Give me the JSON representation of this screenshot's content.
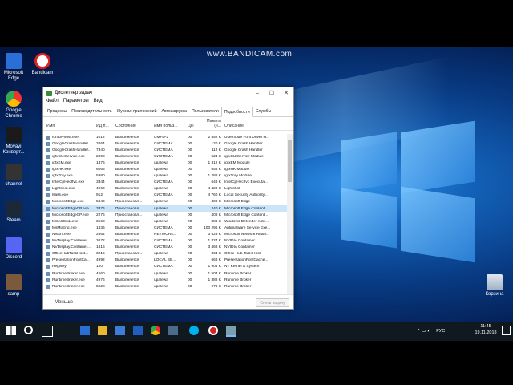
{
  "watermark": "www.BANDICAM.com",
  "desktop_icons": [
    {
      "label": "Microsoft Edge",
      "icon": "edge-icon",
      "color": "#2a6fd6"
    },
    {
      "label": "Bandicam",
      "icon": "bandicam-icon",
      "color": "#d22"
    },
    {
      "label": "Google Chrome",
      "icon": "chrome-icon",
      "color": "#e33"
    },
    {
      "label": "Movavi Конверт...",
      "icon": "movavi-icon",
      "color": "#1a1a1a"
    },
    {
      "label": "channel",
      "icon": "file-icon",
      "color": "#333"
    },
    {
      "label": "Steam",
      "icon": "steam-icon",
      "color": "#1b2838"
    },
    {
      "label": "Discord",
      "icon": "discord-icon",
      "color": "#5865f2"
    },
    {
      "label": "samp",
      "icon": "samp-icon",
      "color": "#7a5a3a"
    }
  ],
  "recycle_bin": {
    "label": "Корзина",
    "icon": "recycle-bin-icon"
  },
  "task_manager": {
    "title": "Диспетчер задач",
    "menu": [
      "Файл",
      "Параметры",
      "Вид"
    ],
    "tabs": [
      "Процессы",
      "Производительность",
      "Журнал приложений",
      "Автозагрузка",
      "Пользователи",
      "Подробности",
      "Службы"
    ],
    "active_tab": "Подробности",
    "columns": [
      "Имя",
      "ИД п...",
      "Состояние",
      "Имя польз...",
      "ЦП",
      "Память (ч...",
      "Описание"
    ],
    "rows": [
      [
        "fontdrvhost.exe",
        "1012",
        "Выполняется",
        "UMFD-2",
        "00",
        "2 852 K",
        "Usermode Font Driver H..."
      ],
      [
        "GoogleCrashHandler...",
        "3264",
        "Выполняется",
        "СИСТЕМА",
        "00",
        "120 K",
        "Google Crash Handler"
      ],
      [
        "GoogleCrashHandler...",
        "7340",
        "Выполняется",
        "СИСТЕМА",
        "00",
        "112 K",
        "Google Crash Handler"
      ],
      [
        "igfxCUIService.exe",
        "2808",
        "Выполняется",
        "СИСТЕМА",
        "00",
        "524 K",
        "igfxCUIService Module"
      ],
      [
        "igfxEM.exe",
        "1476",
        "Выполняется",
        "upalewa",
        "00",
        "1 312 K",
        "igfxEM Module"
      ],
      [
        "igfxHK.exe",
        "6068",
        "Выполняется",
        "upalewa",
        "00",
        "656 K",
        "igfxHK Module"
      ],
      [
        "igfxTray.exe",
        "5980",
        "Выполняется",
        "upalewa",
        "00",
        "1 288 K",
        "igfxTray Module"
      ],
      [
        "IntelCpHecIfvc.exe",
        "3344",
        "Выполняется",
        "СИСТЕМА",
        "00",
        "648 K",
        "IntelCpHecIfvc Executa..."
      ],
      [
        "Lightshot.exe",
        "4960",
        "Выполняется",
        "upalewa",
        "00",
        "4 420 K",
        "Lightshot"
      ],
      [
        "lsass.exe",
        "912",
        "Выполняется",
        "СИСТЕМА",
        "00",
        "4 760 K",
        "Local Security Authority..."
      ],
      [
        "MicrosoftEdge.exe",
        "5840",
        "Приостановл...",
        "upalewa",
        "00",
        "408 K",
        "Microsoft Edge"
      ],
      [
        "MicrosoftEdgeCP.exe",
        "3376",
        "Приостановл...",
        "upalewa",
        "00",
        "240 K",
        "Microsoft Edge Content..."
      ],
      [
        "MicrosoftEdgeCP.exe",
        "2276",
        "Приостановл...",
        "upalewa",
        "00",
        "408 K",
        "Microsoft Edge Content..."
      ],
      [
        "MSASCuiL.exe",
        "3168",
        "Выполняется",
        "upalewa",
        "00",
        "888 K",
        "Windows Defender notif..."
      ],
      [
        "MsMpEng.exe",
        "1836",
        "Выполняется",
        "СИСТЕМА",
        "00",
        "100 296 K",
        "Antimalware Service Exe..."
      ],
      [
        "NisSrv.exe",
        "2664",
        "Выполняется",
        "NETWORK...",
        "00",
        "3 523 K",
        "Microsoft Network Realti..."
      ],
      [
        "NVDisplay.Container...",
        "3672",
        "Выполняется",
        "СИСТЕМА",
        "00",
        "1 324 K",
        "NVIDIA Container"
      ],
      [
        "NVDisplay.Container...",
        "1616",
        "Выполняется",
        "СИСТЕМА",
        "00",
        "3 468 K",
        "NVIDIA Container"
      ],
      [
        "OfficeHubTaskHost...",
        "3216",
        "Приостановл...",
        "upalewa",
        "00",
        "364 K",
        "Office Hub Task Host"
      ],
      [
        "PresentationFontCa...",
        "4992",
        "Выполняется",
        "LOCAL SE...",
        "00",
        "668 K",
        "PresentationFontCache..."
      ],
      [
        "Registry",
        "120",
        "Выполняется",
        "СИСТЕМА",
        "00",
        "1 904 K",
        "NT Kernel & System"
      ],
      [
        "RuntimeBroker.exe",
        "4560",
        "Выполняется",
        "upalewa",
        "00",
        "1 504 K",
        "Runtime Broker"
      ],
      [
        "RuntimeBroker.exe",
        "4976",
        "Выполняется",
        "upalewa",
        "00",
        "1 388 K",
        "Runtime Broker"
      ],
      [
        "RuntimeBroker.exe",
        "5228",
        "Выполняется",
        "upalewa",
        "00",
        "976 K",
        "Runtime Broker"
      ]
    ],
    "selected_row": 11,
    "footer_less": "Меньше",
    "end_task": "Снять задачу"
  },
  "taskbar": {
    "tray_language": "РУС",
    "time": "11:45",
    "date": "19.11.2018"
  }
}
